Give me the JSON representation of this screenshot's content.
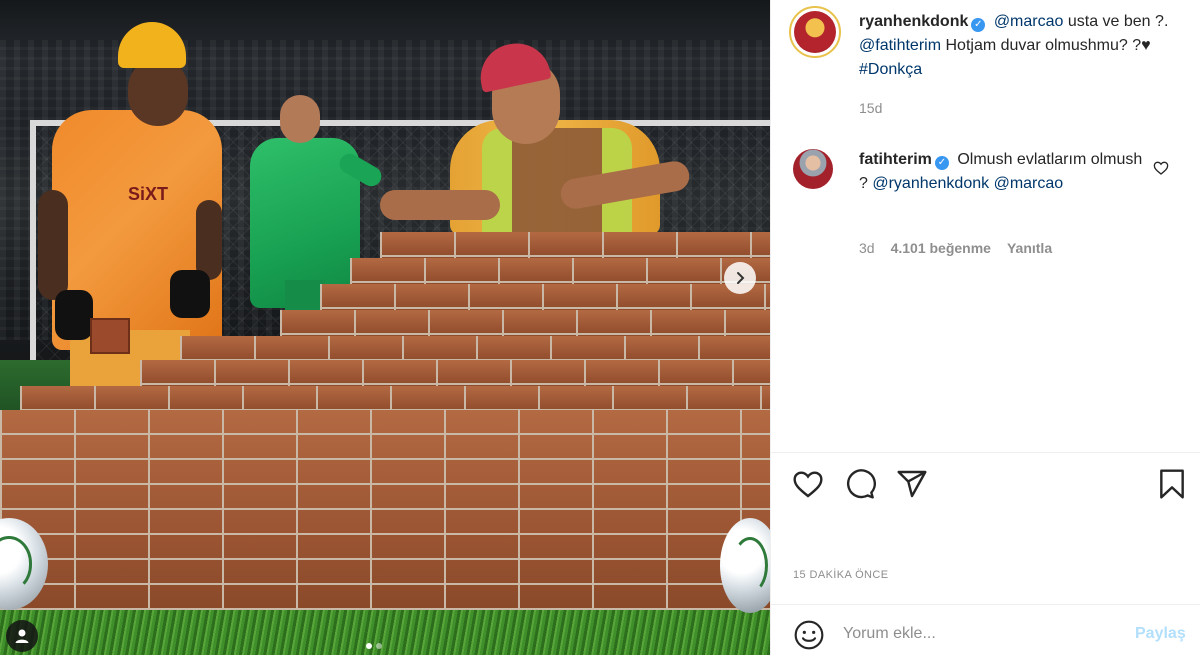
{
  "post": {
    "author": {
      "username": "ryanhenkdonk",
      "verified_icon": "verified-badge-icon"
    },
    "caption": {
      "mention_1": "@marcao",
      "text_1": " usta ve ben ",
      "emoji_1": "?",
      "text_2": ". ",
      "mention_2": "@fatihterim",
      "text_3": " Hotjam duvar olmushmu? ",
      "emoji_2": "?",
      "heart": "♥",
      "text_4": " ",
      "hashtag": "#Donkça"
    },
    "caption_time": "15d",
    "media": {
      "jersey_text": "SiXT",
      "next_icon": "chevron-right-icon",
      "tag_icon": "user-tag-icon",
      "carousel_count": 2,
      "carousel_active": 1
    }
  },
  "comments": [
    {
      "username": "fatihterim",
      "text_1": " Olmush evlatlarım olmush ",
      "emoji": "?",
      "text_2": " ",
      "mention_1": "@ryanhenkdonk",
      "text_3": " ",
      "mention_2": "@marcao",
      "time": "3d",
      "likes": "4.101 beğenme",
      "reply": "Yanıtla"
    }
  ],
  "actions": {
    "like_icon": "heart-icon",
    "comment_icon": "comment-icon",
    "share_icon": "send-icon",
    "save_icon": "bookmark-icon"
  },
  "post_time": "15 DAKİKA ÖNCE",
  "comment_box": {
    "placeholder": "Yorum ekle...",
    "submit": "Paylaş",
    "emoji_icon": "smiley-icon"
  },
  "colors": {
    "link": "#00376b",
    "verified": "#3897f0",
    "muted": "#8e8e8e",
    "submit_disabled": "#b2dffc"
  }
}
